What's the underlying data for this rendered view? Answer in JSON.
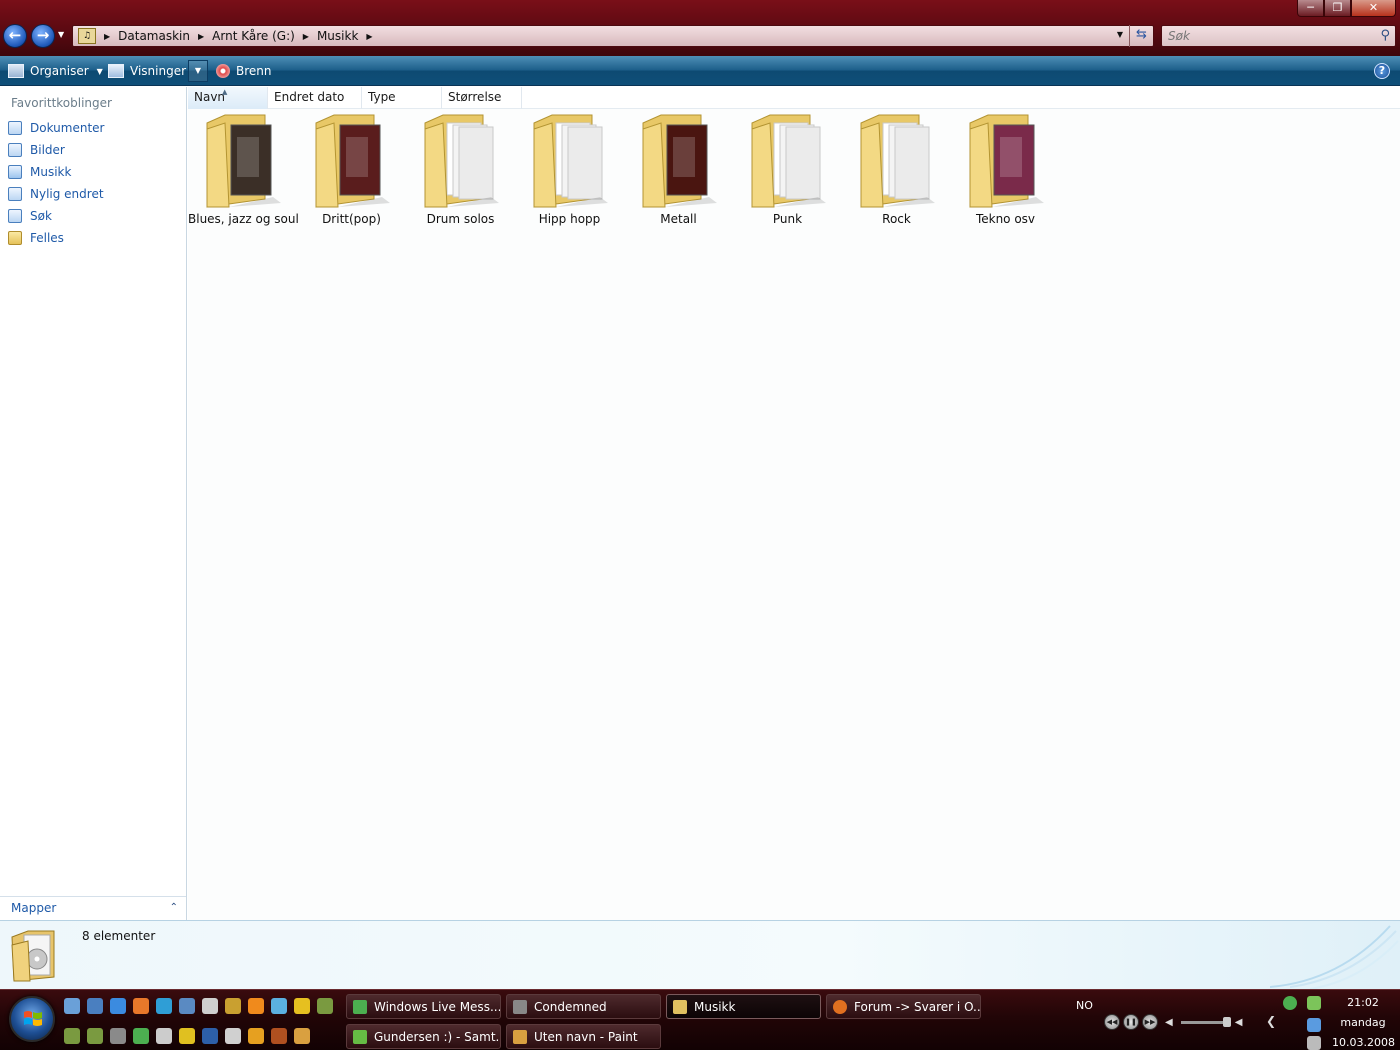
{
  "window": {
    "title_buttons": [
      "minimize",
      "maximize",
      "close"
    ]
  },
  "address": {
    "breadcrumbs": [
      "Datamaskin",
      "Arnt Kåre (G:)",
      "Musikk"
    ]
  },
  "search": {
    "placeholder": "Søk"
  },
  "commands": {
    "organise": "Organiser",
    "views": "Visninger",
    "burn": "Brenn"
  },
  "sidebar": {
    "favorites_title": "Favorittkoblinger",
    "items": [
      {
        "label": "Dokumenter",
        "icon": "documents-icon"
      },
      {
        "label": "Bilder",
        "icon": "pictures-icon"
      },
      {
        "label": "Musikk",
        "icon": "music-icon"
      },
      {
        "label": "Nylig endret",
        "icon": "recently-changed-icon"
      },
      {
        "label": "Søk",
        "icon": "searches-icon"
      },
      {
        "label": "Felles",
        "icon": "public-folder-icon"
      }
    ],
    "folders_label": "Mapper"
  },
  "columns": [
    "Navn",
    "Endret dato",
    "Type",
    "Størrelse"
  ],
  "folders": [
    {
      "name": "Blues, jazz og soul",
      "cover": "#3b2f27"
    },
    {
      "name": "Dritt(pop)",
      "cover": "#5a1d1d"
    },
    {
      "name": "Drum solos",
      "cover": ""
    },
    {
      "name": "Hipp hopp",
      "cover": ""
    },
    {
      "name": "Metall",
      "cover": "#4a1510"
    },
    {
      "name": "Punk",
      "cover": ""
    },
    {
      "name": "Rock",
      "cover": ""
    },
    {
      "name": "Tekno osv",
      "cover": "#7a2a4a"
    }
  ],
  "details": {
    "count": "8 elementer"
  },
  "taskbar": {
    "buttons": [
      {
        "label": "Windows Live Mess...",
        "color": "#4caf50"
      },
      {
        "label": "Condemned",
        "color": "#888888"
      },
      {
        "label": "Musikk",
        "color": "#e0c060"
      },
      {
        "label": "Forum -> Svarer i O...",
        "color": "#e07020"
      },
      {
        "label": "Gundersen :) - Samt...",
        "color": "#66bb44"
      },
      {
        "label": "Uten navn - Paint",
        "color": "#d9a040"
      }
    ],
    "language": "NO",
    "clock": {
      "time": "21:02",
      "day": "mandag",
      "date": "10.03.2008"
    }
  },
  "colors": {
    "accent": "#1f5aa8",
    "titlebar": "#5e0a12",
    "commandbar": "#1d5f8a"
  }
}
